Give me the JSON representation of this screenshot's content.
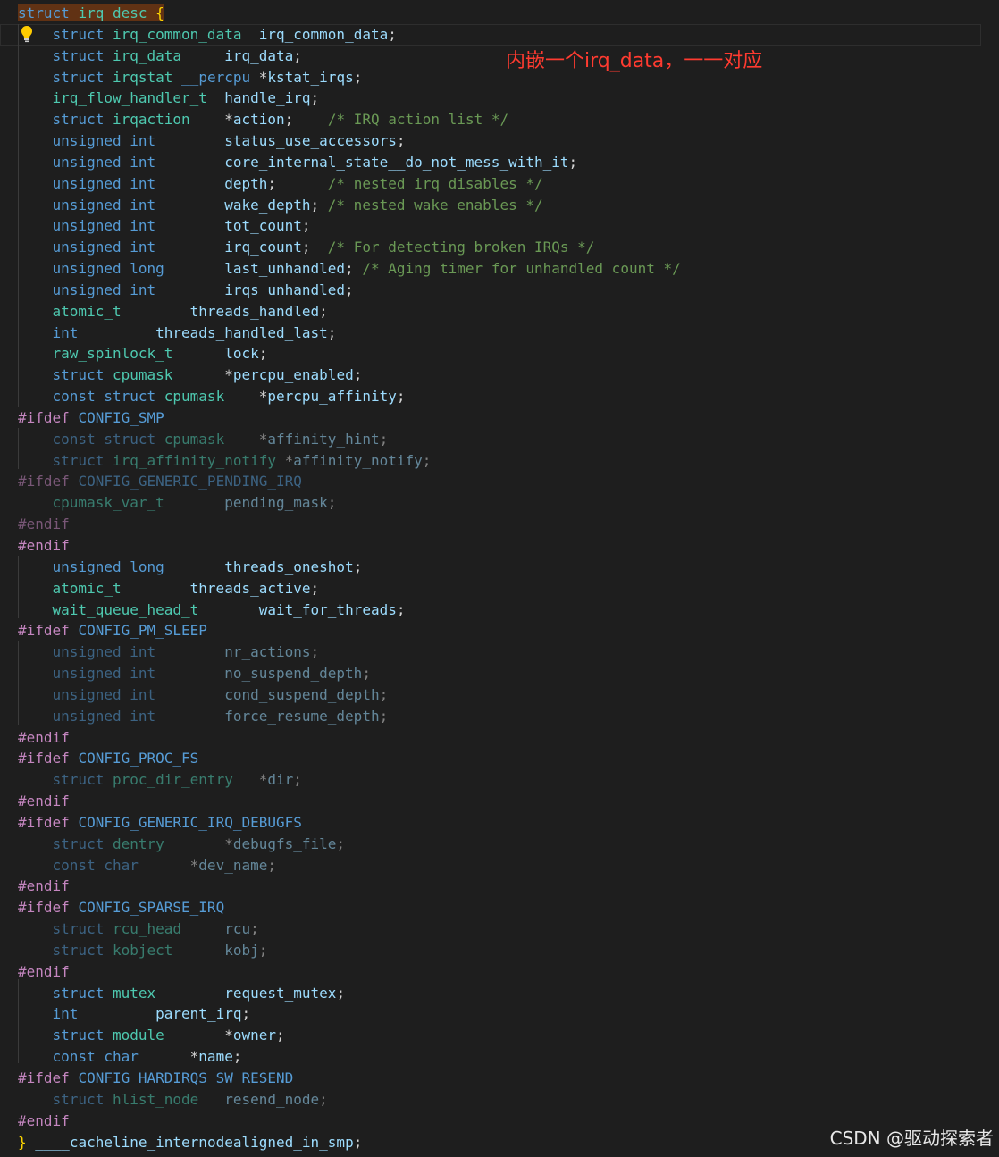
{
  "annotation": "内嵌一个irq_data，一一对应",
  "watermark": "CSDN @驱动探索者",
  "lines": [
    {
      "tokens": [
        [
          "kw",
          "struct "
        ],
        [
          "type",
          "irq_desc"
        ],
        [
          "pun",
          " "
        ],
        [
          "brace",
          "{"
        ]
      ],
      "sel": true
    },
    {
      "tokens": [
        [
          "pun",
          "    "
        ],
        [
          "kw",
          "struct "
        ],
        [
          "type",
          "irq_common_data"
        ],
        [
          "pun",
          "  "
        ],
        [
          "id",
          "irq_common_data"
        ],
        [
          "pun",
          ";"
        ]
      ],
      "cur": true
    },
    {
      "tokens": [
        [
          "pun",
          "    "
        ],
        [
          "kw",
          "struct "
        ],
        [
          "type",
          "irq_data"
        ],
        [
          "pun",
          "     "
        ],
        [
          "id",
          "irq_data"
        ],
        [
          "pun",
          ";"
        ]
      ]
    },
    {
      "tokens": [
        [
          "pun",
          "    "
        ],
        [
          "kw",
          "struct "
        ],
        [
          "type",
          "irqstat"
        ],
        [
          "pun",
          " "
        ],
        [
          "kw",
          "__percpu"
        ],
        [
          "pun",
          " *"
        ],
        [
          "id",
          "kstat_irqs"
        ],
        [
          "pun",
          ";"
        ]
      ]
    },
    {
      "tokens": [
        [
          "pun",
          "    "
        ],
        [
          "type",
          "irq_flow_handler_t"
        ],
        [
          "pun",
          "  "
        ],
        [
          "id",
          "handle_irq"
        ],
        [
          "pun",
          ";"
        ]
      ]
    },
    {
      "tokens": [
        [
          "pun",
          "    "
        ],
        [
          "kw",
          "struct "
        ],
        [
          "type",
          "irqaction"
        ],
        [
          "pun",
          "    *"
        ],
        [
          "id",
          "action"
        ],
        [
          "pun",
          ";    "
        ],
        [
          "cm",
          "/* IRQ action list */"
        ]
      ]
    },
    {
      "tokens": [
        [
          "pun",
          "    "
        ],
        [
          "kw",
          "unsigned int"
        ],
        [
          "pun",
          "        "
        ],
        [
          "id",
          "status_use_accessors"
        ],
        [
          "pun",
          ";"
        ]
      ]
    },
    {
      "tokens": [
        [
          "pun",
          "    "
        ],
        [
          "kw",
          "unsigned int"
        ],
        [
          "pun",
          "        "
        ],
        [
          "id",
          "core_internal_state__do_not_mess_with_it"
        ],
        [
          "pun",
          ";"
        ]
      ]
    },
    {
      "tokens": [
        [
          "pun",
          "    "
        ],
        [
          "kw",
          "unsigned int"
        ],
        [
          "pun",
          "        "
        ],
        [
          "id",
          "depth"
        ],
        [
          "pun",
          ";      "
        ],
        [
          "cm",
          "/* nested irq disables */"
        ]
      ]
    },
    {
      "tokens": [
        [
          "pun",
          "    "
        ],
        [
          "kw",
          "unsigned int"
        ],
        [
          "pun",
          "        "
        ],
        [
          "id",
          "wake_depth"
        ],
        [
          "pun",
          "; "
        ],
        [
          "cm",
          "/* nested wake enables */"
        ]
      ]
    },
    {
      "tokens": [
        [
          "pun",
          "    "
        ],
        [
          "kw",
          "unsigned int"
        ],
        [
          "pun",
          "        "
        ],
        [
          "id",
          "tot_count"
        ],
        [
          "pun",
          ";"
        ]
      ]
    },
    {
      "tokens": [
        [
          "pun",
          "    "
        ],
        [
          "kw",
          "unsigned int"
        ],
        [
          "pun",
          "        "
        ],
        [
          "id",
          "irq_count"
        ],
        [
          "pun",
          ";  "
        ],
        [
          "cm",
          "/* For detecting broken IRQs */"
        ]
      ]
    },
    {
      "tokens": [
        [
          "pun",
          "    "
        ],
        [
          "kw",
          "unsigned long"
        ],
        [
          "pun",
          "       "
        ],
        [
          "id",
          "last_unhandled"
        ],
        [
          "pun",
          "; "
        ],
        [
          "cm",
          "/* Aging timer for unhandled count */"
        ]
      ]
    },
    {
      "tokens": [
        [
          "pun",
          "    "
        ],
        [
          "kw",
          "unsigned int"
        ],
        [
          "pun",
          "        "
        ],
        [
          "id",
          "irqs_unhandled"
        ],
        [
          "pun",
          ";"
        ]
      ]
    },
    {
      "tokens": [
        [
          "pun",
          "    "
        ],
        [
          "type",
          "atomic_t"
        ],
        [
          "pun",
          "        "
        ],
        [
          "id",
          "threads_handled"
        ],
        [
          "pun",
          ";"
        ]
      ]
    },
    {
      "tokens": [
        [
          "pun",
          "    "
        ],
        [
          "kw",
          "int"
        ],
        [
          "pun",
          "         "
        ],
        [
          "id",
          "threads_handled_last"
        ],
        [
          "pun",
          ";"
        ]
      ]
    },
    {
      "tokens": [
        [
          "pun",
          "    "
        ],
        [
          "type",
          "raw_spinlock_t"
        ],
        [
          "pun",
          "      "
        ],
        [
          "id",
          "lock"
        ],
        [
          "pun",
          ";"
        ]
      ]
    },
    {
      "tokens": [
        [
          "pun",
          "    "
        ],
        [
          "kw",
          "struct "
        ],
        [
          "type",
          "cpumask"
        ],
        [
          "pun",
          "      *"
        ],
        [
          "id",
          "percpu_enabled"
        ],
        [
          "pun",
          ";"
        ]
      ]
    },
    {
      "tokens": [
        [
          "pun",
          "    "
        ],
        [
          "kw",
          "const struct "
        ],
        [
          "type",
          "cpumask"
        ],
        [
          "pun",
          "    *"
        ],
        [
          "id",
          "percpu_affinity"
        ],
        [
          "pun",
          ";"
        ]
      ]
    },
    {
      "tokens": [
        [
          "pp",
          "#ifdef "
        ],
        [
          "macro",
          "CONFIG_SMP"
        ]
      ]
    },
    {
      "tokens": [
        [
          "pun",
          "    "
        ],
        [
          "kw",
          "const struct "
        ],
        [
          "type",
          "cpumask"
        ],
        [
          "pun",
          "    *"
        ],
        [
          "id",
          "affinity_hint"
        ],
        [
          "pun",
          ";"
        ]
      ],
      "dim": true
    },
    {
      "tokens": [
        [
          "pun",
          "    "
        ],
        [
          "kw",
          "struct "
        ],
        [
          "type",
          "irq_affinity_notify"
        ],
        [
          "pun",
          " *"
        ],
        [
          "id",
          "affinity_notify"
        ],
        [
          "pun",
          ";"
        ]
      ],
      "dim": true
    },
    {
      "tokens": [
        [
          "pp",
          "#ifdef "
        ],
        [
          "macro",
          "CONFIG_GENERIC_PENDING_IRQ"
        ]
      ],
      "dim": true
    },
    {
      "tokens": [
        [
          "pun",
          "    "
        ],
        [
          "type",
          "cpumask_var_t"
        ],
        [
          "pun",
          "       "
        ],
        [
          "id",
          "pending_mask"
        ],
        [
          "pun",
          ";"
        ]
      ],
      "dim": true
    },
    {
      "tokens": [
        [
          "pp",
          "#endif"
        ]
      ],
      "dim": true
    },
    {
      "tokens": [
        [
          "pp",
          "#endif"
        ]
      ]
    },
    {
      "tokens": [
        [
          "pun",
          "    "
        ],
        [
          "kw",
          "unsigned long"
        ],
        [
          "pun",
          "       "
        ],
        [
          "id",
          "threads_oneshot"
        ],
        [
          "pun",
          ";"
        ]
      ]
    },
    {
      "tokens": [
        [
          "pun",
          "    "
        ],
        [
          "type",
          "atomic_t"
        ],
        [
          "pun",
          "        "
        ],
        [
          "id",
          "threads_active"
        ],
        [
          "pun",
          ";"
        ]
      ]
    },
    {
      "tokens": [
        [
          "pun",
          "    "
        ],
        [
          "type",
          "wait_queue_head_t"
        ],
        [
          "pun",
          "       "
        ],
        [
          "id",
          "wait_for_threads"
        ],
        [
          "pun",
          ";"
        ]
      ]
    },
    {
      "tokens": [
        [
          "pp",
          "#ifdef "
        ],
        [
          "macro",
          "CONFIG_PM_SLEEP"
        ]
      ]
    },
    {
      "tokens": [
        [
          "pun",
          "    "
        ],
        [
          "kw",
          "unsigned int"
        ],
        [
          "pun",
          "        "
        ],
        [
          "id",
          "nr_actions"
        ],
        [
          "pun",
          ";"
        ]
      ],
      "dim": true
    },
    {
      "tokens": [
        [
          "pun",
          "    "
        ],
        [
          "kw",
          "unsigned int"
        ],
        [
          "pun",
          "        "
        ],
        [
          "id",
          "no_suspend_depth"
        ],
        [
          "pun",
          ";"
        ]
      ],
      "dim": true
    },
    {
      "tokens": [
        [
          "pun",
          "    "
        ],
        [
          "kw",
          "unsigned int"
        ],
        [
          "pun",
          "        "
        ],
        [
          "id",
          "cond_suspend_depth"
        ],
        [
          "pun",
          ";"
        ]
      ],
      "dim": true
    },
    {
      "tokens": [
        [
          "pun",
          "    "
        ],
        [
          "kw",
          "unsigned int"
        ],
        [
          "pun",
          "        "
        ],
        [
          "id",
          "force_resume_depth"
        ],
        [
          "pun",
          ";"
        ]
      ],
      "dim": true
    },
    {
      "tokens": [
        [
          "pp",
          "#endif"
        ]
      ]
    },
    {
      "tokens": [
        [
          "pp",
          "#ifdef "
        ],
        [
          "macro",
          "CONFIG_PROC_FS"
        ]
      ]
    },
    {
      "tokens": [
        [
          "pun",
          "    "
        ],
        [
          "kw",
          "struct "
        ],
        [
          "type",
          "proc_dir_entry"
        ],
        [
          "pun",
          "   *"
        ],
        [
          "id",
          "dir"
        ],
        [
          "pun",
          ";"
        ]
      ],
      "dim": true
    },
    {
      "tokens": [
        [
          "pp",
          "#endif"
        ]
      ]
    },
    {
      "tokens": [
        [
          "pp",
          "#ifdef "
        ],
        [
          "macro",
          "CONFIG_GENERIC_IRQ_DEBUGFS"
        ]
      ]
    },
    {
      "tokens": [
        [
          "pun",
          "    "
        ],
        [
          "kw",
          "struct "
        ],
        [
          "type",
          "dentry"
        ],
        [
          "pun",
          "       *"
        ],
        [
          "id",
          "debugfs_file"
        ],
        [
          "pun",
          ";"
        ]
      ],
      "dim": true
    },
    {
      "tokens": [
        [
          "pun",
          "    "
        ],
        [
          "kw",
          "const char"
        ],
        [
          "pun",
          "      *"
        ],
        [
          "id",
          "dev_name"
        ],
        [
          "pun",
          ";"
        ]
      ],
      "dim": true
    },
    {
      "tokens": [
        [
          "pp",
          "#endif"
        ]
      ]
    },
    {
      "tokens": [
        [
          "pp",
          "#ifdef "
        ],
        [
          "macro",
          "CONFIG_SPARSE_IRQ"
        ]
      ]
    },
    {
      "tokens": [
        [
          "pun",
          "    "
        ],
        [
          "kw",
          "struct "
        ],
        [
          "type",
          "rcu_head"
        ],
        [
          "pun",
          "     "
        ],
        [
          "id",
          "rcu"
        ],
        [
          "pun",
          ";"
        ]
      ],
      "dim": true
    },
    {
      "tokens": [
        [
          "pun",
          "    "
        ],
        [
          "kw",
          "struct "
        ],
        [
          "type",
          "kobject"
        ],
        [
          "pun",
          "      "
        ],
        [
          "id",
          "kobj"
        ],
        [
          "pun",
          ";"
        ]
      ],
      "dim": true
    },
    {
      "tokens": [
        [
          "pp",
          "#endif"
        ]
      ]
    },
    {
      "tokens": [
        [
          "pun",
          "    "
        ],
        [
          "kw",
          "struct "
        ],
        [
          "type",
          "mutex"
        ],
        [
          "pun",
          "        "
        ],
        [
          "id",
          "request_mutex"
        ],
        [
          "pun",
          ";"
        ]
      ]
    },
    {
      "tokens": [
        [
          "pun",
          "    "
        ],
        [
          "kw",
          "int"
        ],
        [
          "pun",
          "         "
        ],
        [
          "id",
          "parent_irq"
        ],
        [
          "pun",
          ";"
        ]
      ]
    },
    {
      "tokens": [
        [
          "pun",
          "    "
        ],
        [
          "kw",
          "struct "
        ],
        [
          "type",
          "module"
        ],
        [
          "pun",
          "       *"
        ],
        [
          "id",
          "owner"
        ],
        [
          "pun",
          ";"
        ]
      ]
    },
    {
      "tokens": [
        [
          "pun",
          "    "
        ],
        [
          "kw",
          "const char"
        ],
        [
          "pun",
          "      *"
        ],
        [
          "id",
          "name"
        ],
        [
          "pun",
          ";"
        ]
      ]
    },
    {
      "tokens": [
        [
          "pp",
          "#ifdef "
        ],
        [
          "macro",
          "CONFIG_HARDIRQS_SW_RESEND"
        ]
      ]
    },
    {
      "tokens": [
        [
          "pun",
          "    "
        ],
        [
          "kw",
          "struct "
        ],
        [
          "type",
          "hlist_node"
        ],
        [
          "pun",
          "   "
        ],
        [
          "id",
          "resend_node"
        ],
        [
          "pun",
          ";"
        ]
      ],
      "dim": true
    },
    {
      "tokens": [
        [
          "pp",
          "#endif"
        ]
      ]
    },
    {
      "tokens": [
        [
          "brace",
          "}"
        ],
        [
          "pun",
          " "
        ],
        [
          "id",
          "____cacheline_internodealigned_in_smp"
        ],
        [
          "pun",
          ";"
        ]
      ]
    }
  ],
  "colors": {
    "background": "#1e1e1e",
    "keyword": "#569cd6",
    "type": "#4ec9b0",
    "identifier": "#9cdcfe",
    "comment": "#6a9955",
    "preprocessor": "#c586c0",
    "brace": "#ffd700",
    "annotation": "#ff3b30"
  },
  "icons": {
    "lightbulb": "lightbulb-icon"
  }
}
